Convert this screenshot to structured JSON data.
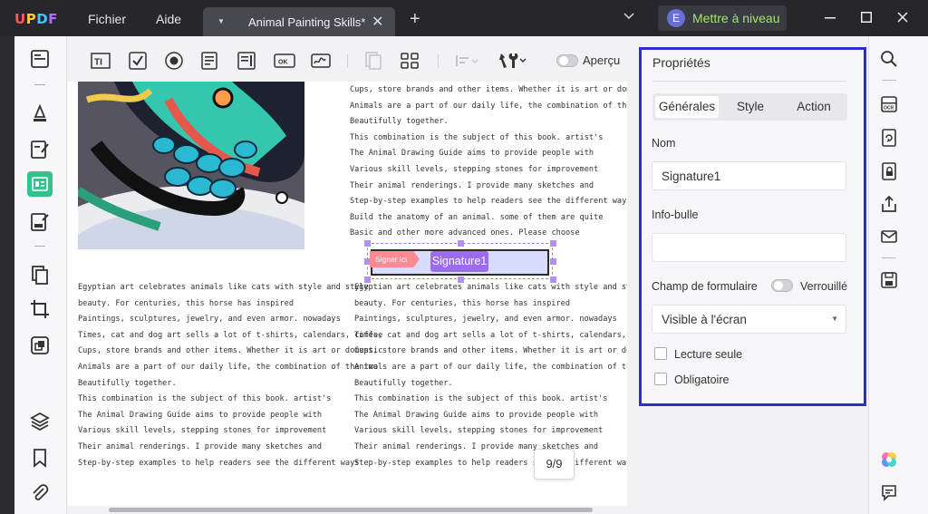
{
  "app": {
    "logo": "UPDF"
  },
  "menu": {
    "file": "Fichier",
    "help": "Aide"
  },
  "tab": {
    "title": "Animal Painting Skills*"
  },
  "account": {
    "avatar_letter": "E",
    "upgrade_label": "Mettre à niveau"
  },
  "toolbar": {
    "preview_label": "Aperçu"
  },
  "document": {
    "right_top_lines": [
      "Cups, store brands and other items. Whether it is art or domestic",
      "Animals are a part of our daily life, the combination of the two",
      "Beautifully together.",
      "This combination is the subject of this book. artist's",
      "The Animal Drawing Guide aims to provide people with",
      "Various skill levels, stepping stones for improvement",
      "Their animal renderings. I provide many sketches and",
      "Step-by-step examples to help readers see the different ways",
      "Build the anatomy of an animal. some of them are quite",
      "Basic and other more advanced ones. Please choose"
    ],
    "left_bottom_lines": [
      "Egyptian art celebrates animals like cats with style and style",
      "beauty. For centuries, this horse has inspired",
      "Paintings, sculptures, jewelry, and even armor. nowadays",
      "Times, cat and dog art sells a lot of t-shirts, calendars, coffee",
      "Cups, store brands and other items. Whether it is art or domestic",
      "Animals are a part of our daily life, the combination of the two",
      "Beautifully together.",
      "This combination is the subject of this book. artist's",
      "The Animal Drawing Guide aims to provide people with",
      "Various skill levels, stepping stones for improvement",
      "Their animal renderings. I provide many sketches and",
      "Step-by-step examples to help readers see the different ways"
    ],
    "right_bottom_lines": [
      "Egyptian art celebrates animals like cats with style and style",
      "beauty. For centuries, this horse has inspired",
      "Paintings, sculptures, jewelry, and even armor. nowadays",
      "Times, cat and dog art sells a lot of t-shirts, calendars, coffee",
      "Cups, store brands and other items. Whether it is art or domestic",
      "Animals are a part of our daily life, the combination of the two",
      "Beautifully together.",
      "This combination is the subject of this book. artist's",
      "The Animal Drawing Guide aims to provide people with",
      "Various skill levels, stepping stones for improvement",
      "Their animal renderings. I provide many sketches and",
      "Step-by-step examples to help readers see the different ways"
    ],
    "signature": {
      "flag": "Signer ici",
      "name": "Signature1"
    },
    "page_indicator": "9/9"
  },
  "properties": {
    "title": "Propriétés",
    "tabs": [
      "Générales",
      "Style",
      "Action"
    ],
    "active_tab": "Générales",
    "name_label": "Nom",
    "name_value": "Signature1",
    "tooltip_label": "Info-bulle",
    "tooltip_value": "",
    "form_field_label": "Champ de formulaire",
    "locked_label": "Verrouillé",
    "visibility": "Visible à l'écran",
    "readonly_label": "Lecture seule",
    "required_label": "Obligatoire"
  },
  "colors": {
    "accent": "#2c2ccf",
    "signature_fill": "#9c6cf0",
    "signature_flag": "#ff8a93",
    "upgrade_text": "#9fe86a"
  }
}
